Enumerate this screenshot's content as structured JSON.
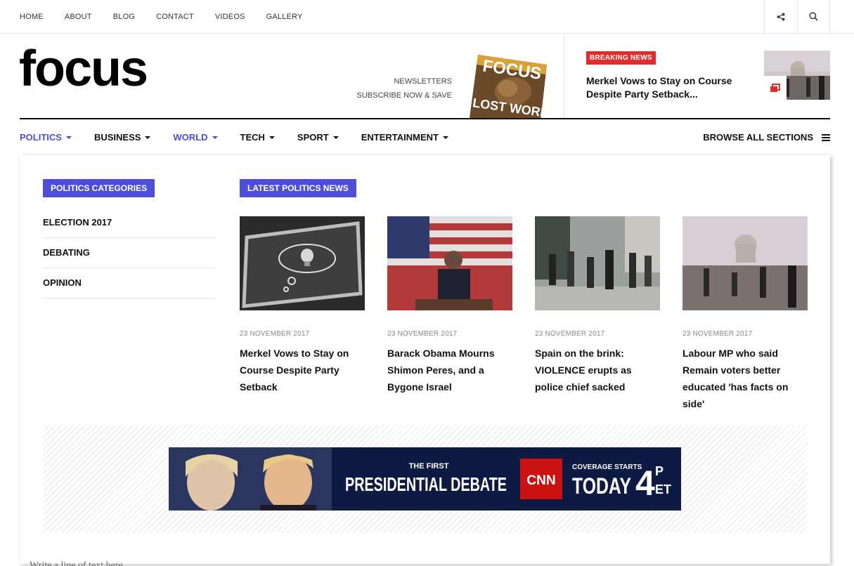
{
  "topnav": [
    "HOME",
    "ABOUT",
    "BLOG",
    "CONTACT",
    "VIDEOS",
    "GALLERY"
  ],
  "icons": {
    "share": "share-icon",
    "search": "search-icon"
  },
  "logo": "focus",
  "newsletter": {
    "line1": "NEWSLETTERS",
    "line2": "SUBSCRIBE NOW & SAVE"
  },
  "magazine": {
    "title": "FOCUS",
    "cover_text": "LOST WORLD"
  },
  "breaking": {
    "badge": "BREAKING NEWS",
    "title": "Merkel Vows to Stay on Course Despite Party Setback..."
  },
  "mainnav": {
    "items": [
      "POLITICS",
      "BUSINESS",
      "WORLD",
      "TECH",
      "SPORT",
      "ENTERTAINMENT"
    ],
    "active": [
      "POLITICS",
      "WORLD"
    ],
    "browse": "BROWSE ALL SECTIONS"
  },
  "panel": {
    "categories_heading": "POLITICS CATEGORIES",
    "categories": [
      "ELECTION 2017",
      "DEBATING",
      "OPINION"
    ],
    "news_heading": "LATEST POLITICS NEWS",
    "articles": [
      {
        "date": "23 NOVEMBER 2017",
        "title": "Merkel Vows to Stay on Course Despite Party Setback"
      },
      {
        "date": "23 NOVEMBER 2017",
        "title": "Barack Obama Mourns Shimon Peres, and a Bygone Israel"
      },
      {
        "date": "23 NOVEMBER 2017",
        "title": "Spain on the brink: VIOLENCE erupts as police chief sacked"
      },
      {
        "date": "23 NOVEMBER 2017",
        "title": "Labour MP who said Remain voters better educated 'has facts on side'"
      }
    ]
  },
  "ad": {
    "line1": "THE FIRST",
    "line2": "PRESIDENTIAL DEBATE",
    "network": "CNN",
    "cov1": "COVERAGE STARTS",
    "cov2": "TODAY",
    "time": "4",
    "time_p": "P",
    "time_et": "ET"
  },
  "colors": {
    "accent": "#4d4dd9",
    "breaking": "#e22b2b"
  },
  "faded_text": "Write a line of text here"
}
